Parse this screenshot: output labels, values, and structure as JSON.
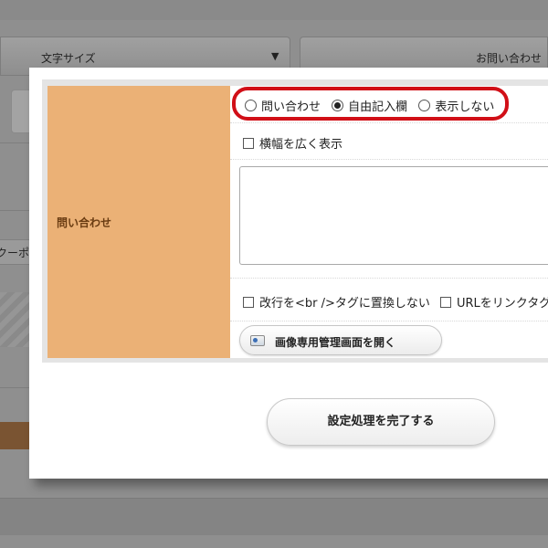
{
  "background": {
    "font_size_label": "文字サイズ",
    "contact_label": "お問い合わせ",
    "coupon_text": "クーポ"
  },
  "form": {
    "field_label": "問い合わせ",
    "radio_options": [
      "問い合わせ",
      "自由記入欄",
      "表示しない"
    ],
    "radio_selected": "自由記入欄",
    "wide_display_label": "横幅を広く表示",
    "textarea_value": "",
    "no_br_label": "改行を<br />タグに置換しない",
    "url_link_label": "URLをリンクタグ",
    "image_manager_button": "画像専用管理画面を開く",
    "complete_button": "設定処理を完了する"
  },
  "colors": {
    "label_bg": "#ebb176",
    "highlight": "#d10f17"
  }
}
